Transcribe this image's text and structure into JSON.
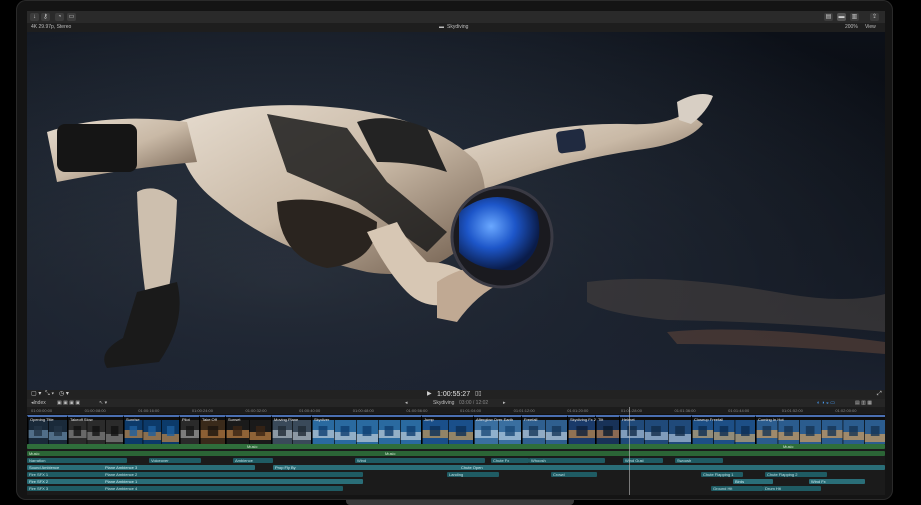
{
  "toolbar": {
    "left_buttons": [
      "import",
      "keywords",
      "background-tasks",
      "share"
    ],
    "right_buttons": [
      "browser-toggle",
      "timeline-toggle",
      "inspector-toggle",
      "share-export"
    ]
  },
  "viewer_bar": {
    "format": "4K 29.97p, Stereo",
    "clip_title": "Skydiving",
    "zoom": "200%",
    "view_label": "View"
  },
  "transport": {
    "timecode": "1:00:55:27"
  },
  "timeline_toolbar": {
    "project_name": "Skydiving",
    "project_duration": "03:00 / 12:02",
    "index_label": "Index"
  },
  "ruler": {
    "ticks": [
      "01:00:00:00",
      "01:00:08:00",
      "01:00:16:00",
      "01:00:24:00",
      "01:00:32:00",
      "01:00:40:00",
      "01:00:48:00",
      "01:00:56:00",
      "01:01:04:00",
      "01:01:12:00",
      "01:01:20:00",
      "01:01:28:00",
      "01:01:36:00",
      "01:01:44:00",
      "01:01:52:00",
      "01:02:00:00"
    ]
  },
  "clips": [
    {
      "name": "Opening Title"
    },
    {
      "name": "Takeoff Slow"
    },
    {
      "name": "Sunrise"
    },
    {
      "name": "Pilot"
    },
    {
      "name": "Take Off"
    },
    {
      "name": "Sunset"
    },
    {
      "name": "Moving Plane"
    },
    {
      "name": "Skydiver"
    },
    {
      "name": "Jump"
    },
    {
      "name": "Afterglow Over Earth"
    },
    {
      "name": "Freefall"
    },
    {
      "name": "Skydiving Fx 2"
    },
    {
      "name": "Tilt"
    },
    {
      "name": "Helmet"
    },
    {
      "name": "Closeup Freefall"
    },
    {
      "name": "Coming In Hot"
    }
  ],
  "audio_lanes": {
    "music_a": "Music",
    "music_b": "Music",
    "music_c": "Music",
    "music_d": "Music",
    "vo_label": "Voiceover",
    "narration": "Narration",
    "ambience": "Ambience",
    "wind": "Wind",
    "chute": "Chute Fx",
    "sound_ambience": "Sound Ambience",
    "plane_ambience_a": "Plane Ambience 3",
    "plane_ambience_b": "Plane Ambience 2",
    "plane_ambience_c": "Plane Ambience 1",
    "plane_ambience_d": "Plane Ambience 4",
    "fire_sfx_a": "Fire SFX 1",
    "fire_sfx_b": "Fire SFX 2",
    "fire_sfx_c": "Fire SFX 3",
    "fire_sfx_d": "Fire SFX 4",
    "prop_fly_by": "Prop Fly By",
    "whoosh": "Whoosh",
    "wind_gust": "Wind Gust",
    "swoosh": "Swoosh",
    "chute_open": "Chute Open",
    "chute_flapping_a": "Chute Flapping 1",
    "chute_flapping_b": "Chute Flapping 2",
    "landing": "Landing",
    "crowd": "Crowd",
    "birds": "Birds",
    "wind_fx": "Wind Fx",
    "ground_hit": "Ground Hit",
    "chute_fall": "Chute Fall",
    "snow": "Snow",
    "drum_hit": "Drum Hit"
  }
}
